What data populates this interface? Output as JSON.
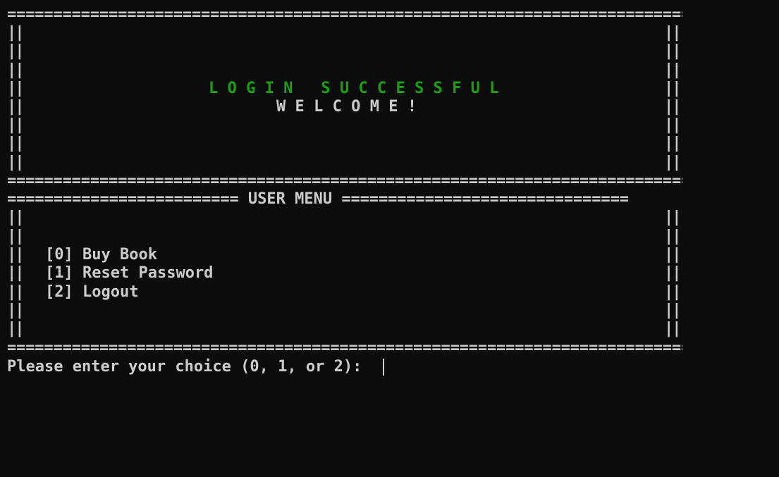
{
  "banner": {
    "rule": "================================================================================",
    "pipe": "||",
    "title": "LOGIN SUCCESSFUL",
    "subtitle": "WELCOME!",
    "title_color": "#16a30b"
  },
  "menu": {
    "rule_left": "=========================",
    "heading": "USER MENU",
    "rule_right": "===============================",
    "items": [
      {
        "key": "[0]",
        "label": "Buy Book"
      },
      {
        "key": "[1]",
        "label": "Reset Password"
      },
      {
        "key": "[2]",
        "label": "Logout"
      }
    ]
  },
  "prompt": {
    "text": "Please enter your choice (0, 1, or 2):"
  },
  "colors": {
    "background": "#0c0c0c",
    "foreground": "#cccccc"
  }
}
